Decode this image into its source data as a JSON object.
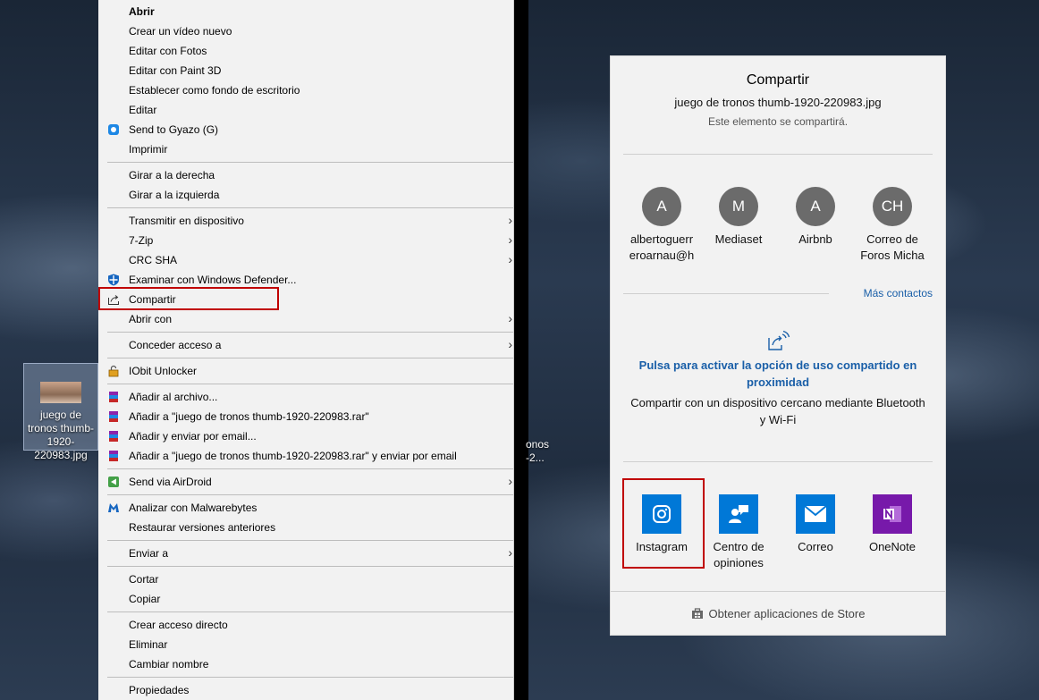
{
  "desktop": {
    "icon_label": "juego de tronos thumb-1920-220983.jpg",
    "right_label": "onos -2..."
  },
  "context_menu": {
    "items": [
      {
        "label": "Abrir",
        "bold": true
      },
      {
        "label": "Crear un vídeo nuevo"
      },
      {
        "label": "Editar con Fotos"
      },
      {
        "label": "Editar con Paint 3D"
      },
      {
        "label": "Establecer como fondo de escritorio"
      },
      {
        "label": "Editar"
      },
      {
        "label": "Send to Gyazo (G)",
        "icon": "gyazo-icon"
      },
      {
        "label": "Imprimir"
      },
      {
        "label": "Girar a la derecha"
      },
      {
        "label": "Girar a la izquierda"
      },
      {
        "label": "Transmitir en dispositivo",
        "submenu": true
      },
      {
        "label": "7-Zip",
        "submenu": true
      },
      {
        "label": "CRC SHA",
        "submenu": true
      },
      {
        "label": "Examinar con Windows Defender...",
        "icon": "windows-defender-icon"
      },
      {
        "label": "Compartir",
        "icon": "share-icon"
      },
      {
        "label": "Abrir con",
        "submenu": true
      },
      {
        "label": "Conceder acceso a",
        "submenu": true
      },
      {
        "label": "IObit Unlocker",
        "icon": "iobit-lock-icon"
      },
      {
        "label": "Añadir al archivo...",
        "icon": "winrar-icon"
      },
      {
        "label": "Añadir a \"juego de tronos thumb-1920-220983.rar\"",
        "icon": "winrar-icon"
      },
      {
        "label": "Añadir y enviar por email...",
        "icon": "winrar-icon"
      },
      {
        "label": "Añadir a \"juego de tronos thumb-1920-220983.rar\" y enviar por email",
        "icon": "winrar-icon"
      },
      {
        "label": "Send via AirDroid",
        "icon": "airdroid-icon",
        "submenu": true
      },
      {
        "label": "Analizar con Malwarebytes",
        "icon": "malwarebytes-icon"
      },
      {
        "label": "Restaurar versiones anteriores"
      },
      {
        "label": "Enviar a",
        "submenu": true
      },
      {
        "label": "Cortar"
      },
      {
        "label": "Copiar"
      },
      {
        "label": "Crear acceso directo"
      },
      {
        "label": "Eliminar"
      },
      {
        "label": "Cambiar nombre"
      },
      {
        "label": "Propiedades"
      }
    ]
  },
  "share_panel": {
    "title": "Compartir",
    "filename": "juego de tronos thumb-1920-220983.jpg",
    "note": "Este elemento se compartirá.",
    "contacts": [
      {
        "initials": "A",
        "name_line1": "albertoguerr",
        "name_line2": "eroarnau@h"
      },
      {
        "initials": "M",
        "name_line1": "Mediaset",
        "name_line2": ""
      },
      {
        "initials": "A",
        "name_line1": "Airbnb",
        "name_line2": ""
      },
      {
        "initials": "CH",
        "name_line1": "Correo de",
        "name_line2": "Foros Micha"
      }
    ],
    "more_contacts": "Más contactos",
    "proximity_title": "Pulsa para activar la opción de uso compartido en proximidad",
    "proximity_desc": "Compartir con un dispositivo cercano mediante Bluetooth y Wi-Fi",
    "apps": [
      {
        "name": "Instagram",
        "icon": "instagram-icon",
        "color": "#0078d7"
      },
      {
        "name": "Centro de opiniones",
        "icon": "feedback-hub-icon",
        "color": "#0078d7"
      },
      {
        "name": "Correo",
        "icon": "mail-icon",
        "color": "#0078d7"
      },
      {
        "name": "OneNote",
        "icon": "onenote-icon",
        "color": "#7719aa"
      }
    ],
    "store_link": "Obtener aplicaciones de Store"
  }
}
